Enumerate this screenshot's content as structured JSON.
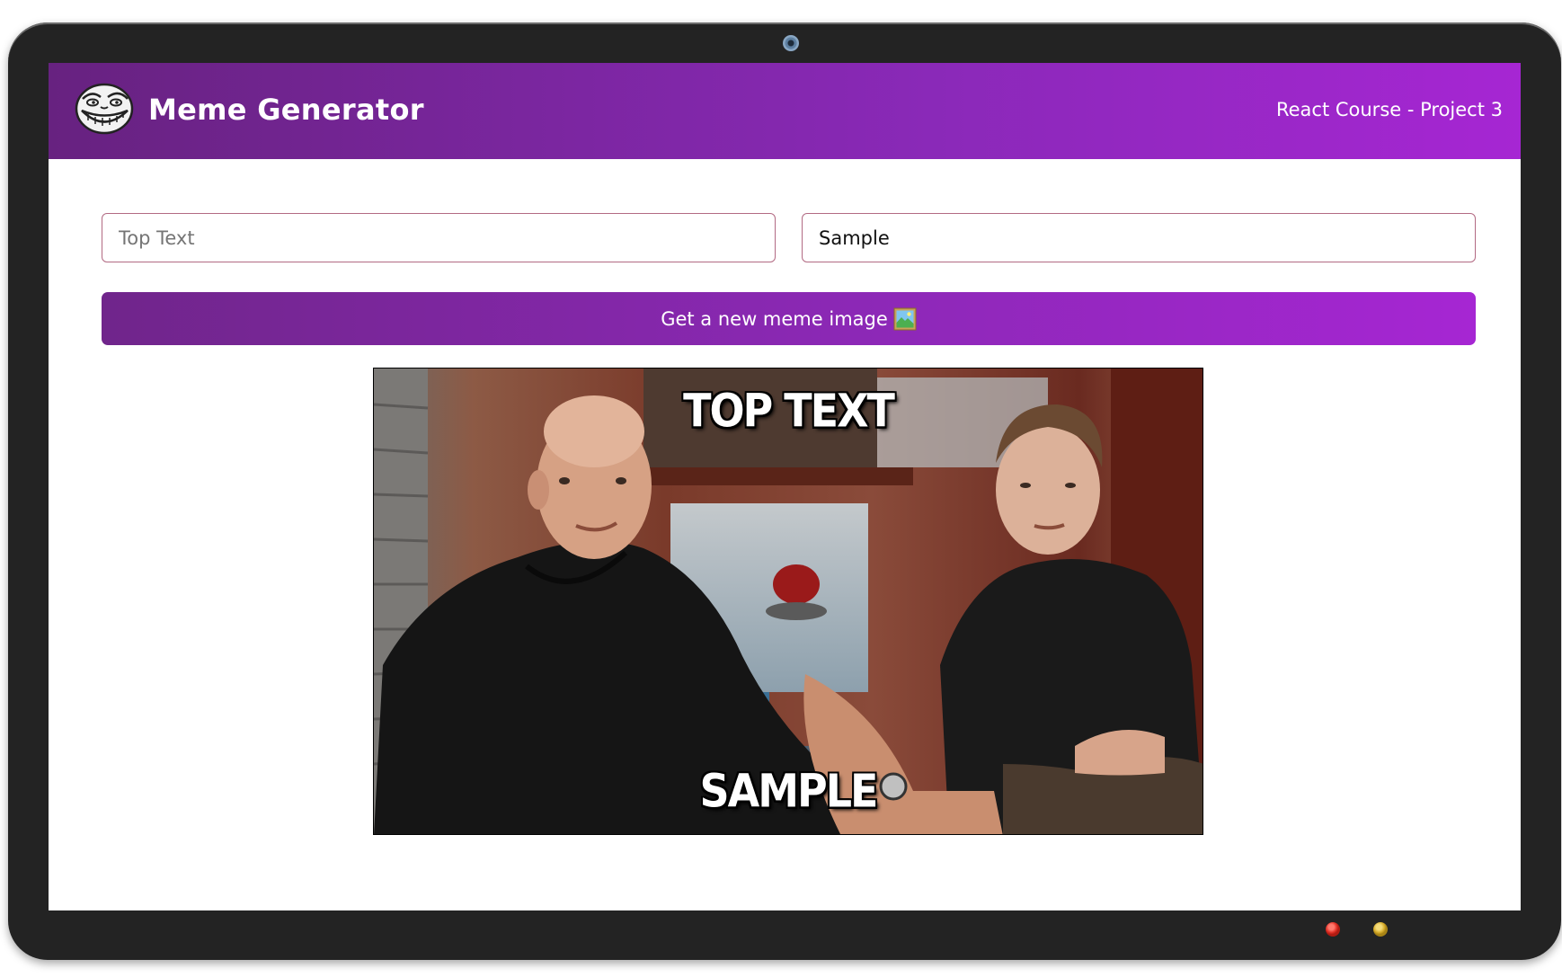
{
  "app": {
    "title": "Meme Generator",
    "subtitle": "React Course - Project 3",
    "logo_icon": "troll-face-icon"
  },
  "form": {
    "top_text": {
      "value": "",
      "placeholder": "Top Text"
    },
    "bottom_text": {
      "value": "Sample",
      "placeholder": ""
    },
    "get_image_button": {
      "label": "Get a new meme image",
      "icon": "framed-picture-icon"
    }
  },
  "meme": {
    "top_text": "Top Text",
    "bottom_text": "Sample"
  },
  "theme": {
    "header_gradient_start": "#672280",
    "header_gradient_end": "#a626d3",
    "input_border": "#b26a83",
    "device_frame": "#232323"
  }
}
